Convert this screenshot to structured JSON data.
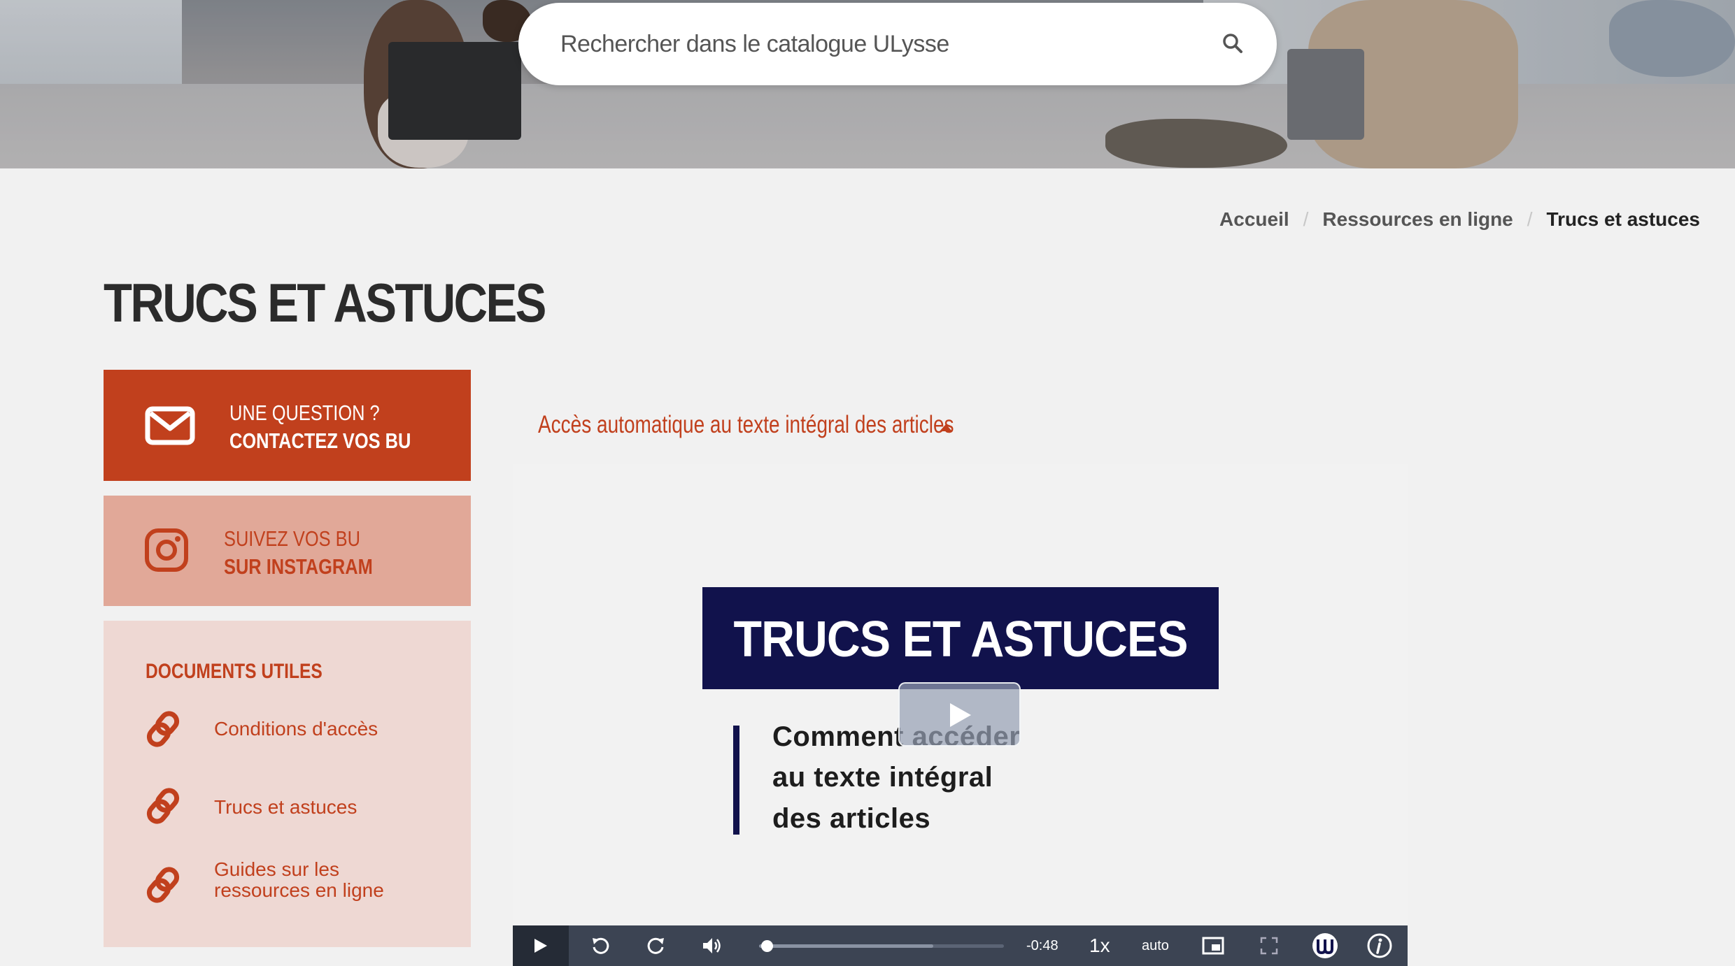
{
  "search": {
    "placeholder": "Rechercher dans le catalogue ULysse"
  },
  "breadcrumb": {
    "items": [
      "Accueil",
      "Ressources en ligne"
    ],
    "current": "Trucs et astuces",
    "separator": "/"
  },
  "page": {
    "title": "TRUCS ET ASTUCES"
  },
  "sidebar": {
    "contact": {
      "line1": "UNE QUESTION ?",
      "line2": "CONTACTEZ VOS BU"
    },
    "instagram": {
      "line1": "SUIVEZ VOS BU",
      "line2": "SUR INSTAGRAM"
    },
    "documents": {
      "heading": "DOCUMENTS UTILES",
      "links": [
        {
          "label": "Conditions d'accès"
        },
        {
          "label": "Trucs et astuces"
        },
        {
          "label": "Guides sur les ressources en ligne"
        }
      ]
    }
  },
  "accordion": {
    "title": "Accès automatique au texte intégral des articles"
  },
  "video": {
    "banner": "TRUCS ET ASTUCES",
    "lines": [
      "Comment accéder",
      "au texte intégral",
      "des articles"
    ],
    "controls": {
      "time": "-0:48",
      "speed": "1x",
      "quality": "auto",
      "progress": 0.03,
      "buffered": 0.71
    }
  },
  "colors": {
    "brand": "#c1401d",
    "navy": "#11124c",
    "player": "#3c4453"
  }
}
